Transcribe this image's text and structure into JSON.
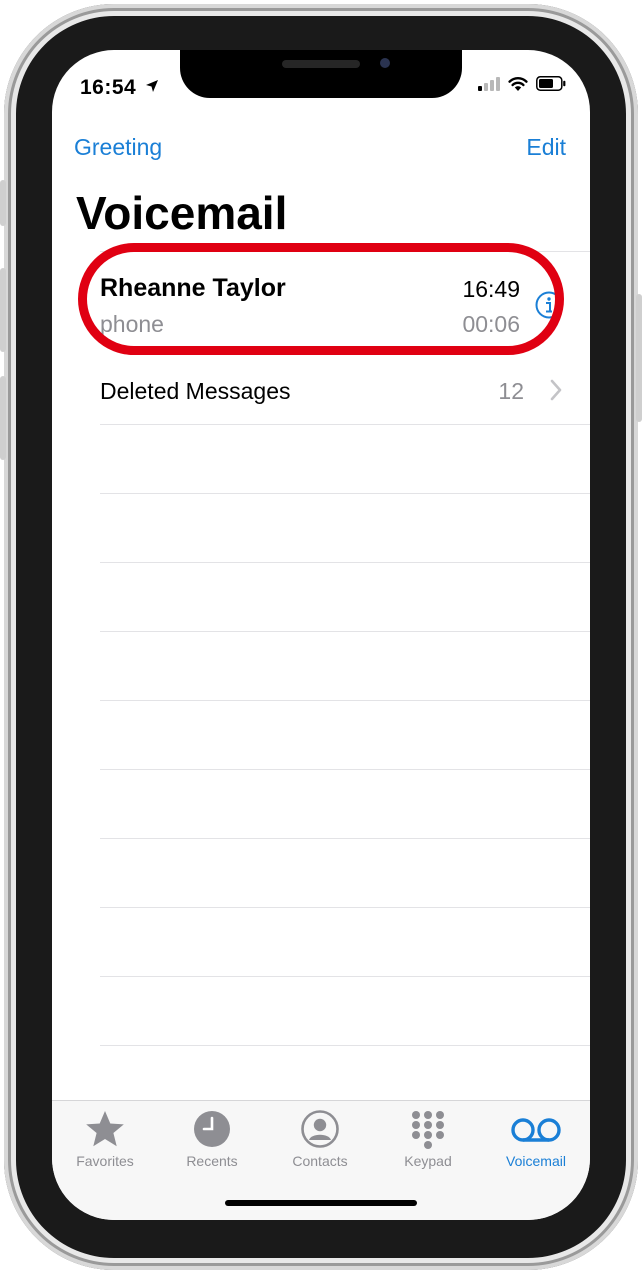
{
  "status_bar": {
    "time": "16:54"
  },
  "nav": {
    "left_label": "Greeting",
    "right_label": "Edit"
  },
  "page": {
    "title": "Voicemail"
  },
  "voicemails": [
    {
      "name": "Rheanne Taylor",
      "source": "phone",
      "time": "16:49",
      "duration": "00:06"
    }
  ],
  "deleted": {
    "label": "Deleted Messages",
    "count": "12"
  },
  "tabs": [
    {
      "label": "Favorites",
      "icon": "star-icon"
    },
    {
      "label": "Recents",
      "icon": "clock-icon"
    },
    {
      "label": "Contacts",
      "icon": "person-icon"
    },
    {
      "label": "Keypad",
      "icon": "keypad-icon"
    },
    {
      "label": "Voicemail",
      "icon": "voicemail-icon",
      "active": true
    }
  ],
  "colors": {
    "accent": "#1a7fd6",
    "highlight": "#e00012",
    "secondary_text": "#8e8e93"
  }
}
